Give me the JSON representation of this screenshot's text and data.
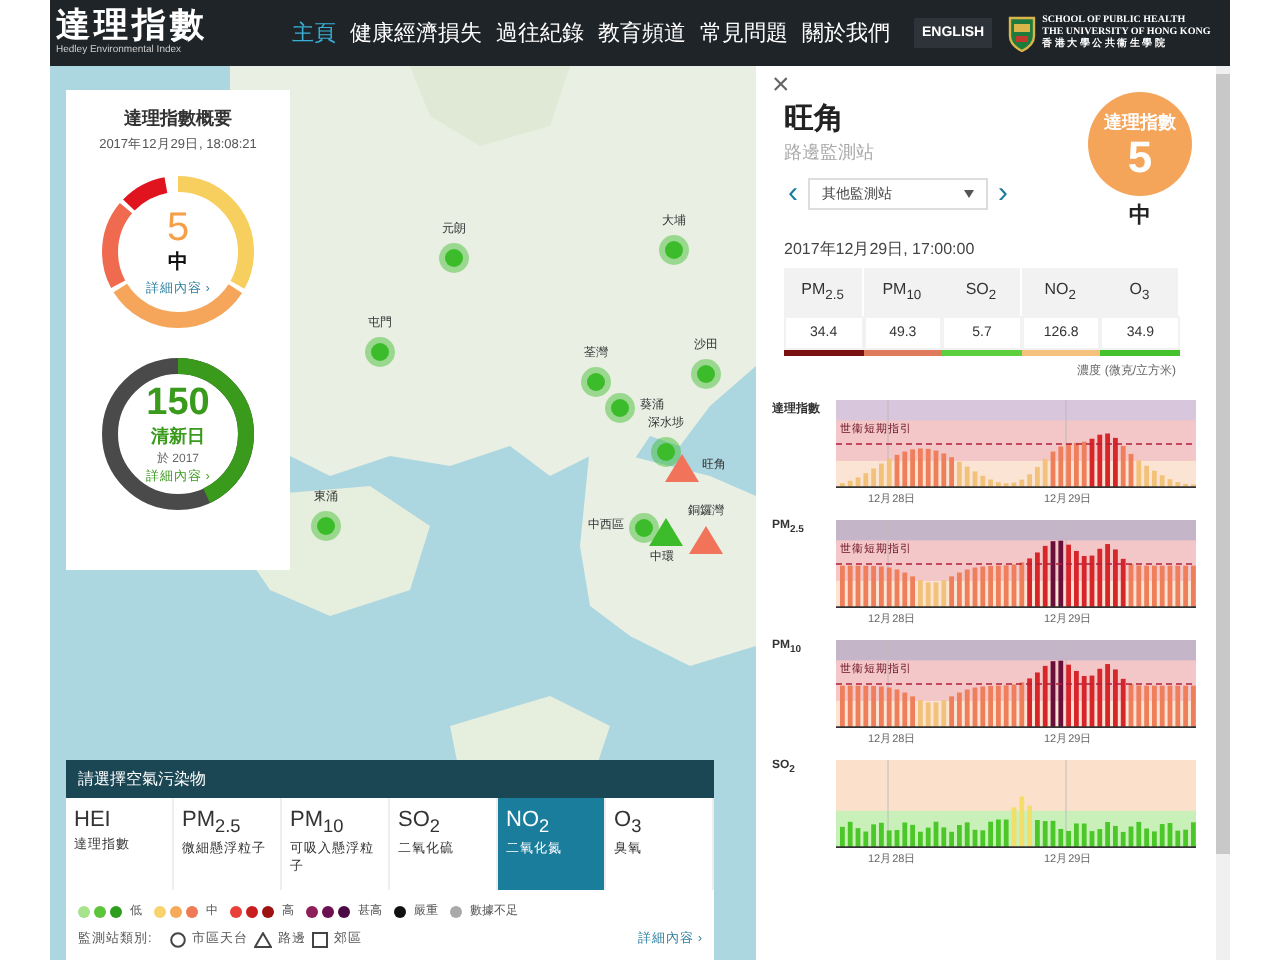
{
  "header": {
    "logo": "達理指數",
    "logo_sub": "Hedley Environmental Index",
    "nav": [
      {
        "label": "主頁",
        "selected": true
      },
      {
        "label": "健康經濟損失",
        "selected": false
      },
      {
        "label": "過往紀錄",
        "selected": false
      },
      {
        "label": "教育頻道",
        "selected": false
      },
      {
        "label": "常見問題",
        "selected": false
      },
      {
        "label": "關於我們",
        "selected": false
      }
    ],
    "language_button": "ENGLISH",
    "school": {
      "line1": "SCHOOL OF PUBLIC HEALTH",
      "line2": "THE UNIVERSITY OF HONG KONG",
      "line3": "香 港 大 學 公 共 衞 生 學 院"
    }
  },
  "summary": {
    "title": "達理指數概要",
    "time": "2017年12月29日, 18:08:21",
    "index": {
      "value": "5",
      "band": "中",
      "link": "詳細內容 ›"
    },
    "clean_days": {
      "value": "150",
      "label": "清新日",
      "year": "於 2017",
      "link": "詳細內容 ›",
      "level": 0.43
    }
  },
  "map": {
    "stations": [
      {
        "name": "元朗",
        "kind": "circle",
        "color": "#3cbc2a"
      },
      {
        "name": "大埔",
        "kind": "circle",
        "color": "#3cbc2a"
      },
      {
        "name": "屯門",
        "kind": "circle",
        "color": "#3cbc2a"
      },
      {
        "name": "荃灣",
        "kind": "circle",
        "color": "#3cbc2a"
      },
      {
        "name": "葵涌",
        "kind": "circle",
        "color": "#3cbc2a"
      },
      {
        "name": "沙田",
        "kind": "circle",
        "color": "#3cbc2a"
      },
      {
        "name": "深水埗",
        "kind": "circle",
        "color": "#3cbc2a"
      },
      {
        "name": "旺角",
        "kind": "triangle",
        "color": "#f0735a"
      },
      {
        "name": "東涌",
        "kind": "circle",
        "color": "#3cbc2a"
      },
      {
        "name": "中西區",
        "kind": "circle",
        "color": "#3cbc2a"
      },
      {
        "name": "中環",
        "kind": "triangle",
        "color": "#3cbc2a"
      },
      {
        "name": "銅鑼灣",
        "kind": "triangle",
        "color": "#f0735a"
      }
    ]
  },
  "pollutant_panel": {
    "title": "請選擇空氣污染物",
    "tabs": [
      {
        "symbol": "HEI",
        "name": "達理指數",
        "selected": false
      },
      {
        "symbol": "PM$_{2.5}$",
        "name": "微細懸浮粒子",
        "selected": false
      },
      {
        "symbol": "PM$_{10}$",
        "name": "可吸入懸浮粒子",
        "selected": false
      },
      {
        "symbol": "SO$_{2}$",
        "name": "二氧化硫",
        "selected": false
      },
      {
        "symbol": "NO$_{2}$",
        "name": "二氧化氮",
        "selected": true
      },
      {
        "symbol": "O$_{3}$",
        "name": "臭氧",
        "selected": false
      }
    ],
    "legend": [
      {
        "label": "低",
        "dots": [
          {
            "color": "#a8e28c"
          },
          {
            "color": "#5cc53c"
          },
          {
            "color": "#2f9e1f"
          }
        ]
      },
      {
        "label": "中",
        "dots": [
          {
            "color": "#f7d36e"
          },
          {
            "color": "#f5aa5c"
          },
          {
            "color": "#ef7b56"
          }
        ]
      },
      {
        "label": "高",
        "dots": [
          {
            "color": "#e8413a"
          },
          {
            "color": "#c81e1e"
          },
          {
            "color": "#9b1313"
          }
        ]
      },
      {
        "label": "甚高",
        "dots": [
          {
            "color": "#8e1f5a"
          },
          {
            "color": "#6b1050"
          },
          {
            "color": "#4a0a45"
          }
        ]
      },
      {
        "label": "嚴重",
        "dots": [
          {
            "color": "#111111"
          }
        ]
      },
      {
        "label": "數據不足",
        "dots": [
          {
            "color": "#aaaaaa"
          }
        ]
      }
    ],
    "station_types_label": "監測站類別:",
    "station_types": [
      {
        "kind": "circle",
        "label": "市區天台"
      },
      {
        "kind": "triangle",
        "label": "路邊"
      },
      {
        "kind": "square",
        "label": "郊區"
      }
    ],
    "link": "詳細內容 ›"
  },
  "station_panel": {
    "close": "×",
    "name": "旺角",
    "type": "路邊監測站",
    "prev": "‹",
    "select": "其他監測站",
    "next": "›",
    "badge": {
      "label": "達理指數",
      "value": "5",
      "band": "中"
    },
    "time": "2017年12月29日, 17:00:00",
    "readings": [
      {
        "pollutant": "PM$_{2.5}$",
        "value": "34.4",
        "color": "#7a1010"
      },
      {
        "pollutant": "PM$_{10}$",
        "value": "49.3",
        "color": "#e07a5c"
      },
      {
        "pollutant": "SO$_{2}$",
        "value": "5.7",
        "color": "#5ccf3c"
      },
      {
        "pollutant": "NO$_{2}$",
        "value": "126.8",
        "color": "#f5c27e"
      },
      {
        "pollutant": "O$_{3}$",
        "value": "34.9",
        "color": "#43c22c"
      }
    ],
    "unit": "濃度 (微克/立方米)",
    "charts": [
      {
        "title": "達理指數",
        "guideline": "世衞短期指引",
        "dates": [
          "12月28日",
          "12月29日"
        ]
      },
      {
        "title": "PM$_{2.5}$",
        "guideline": "世衞短期指引",
        "dates": [
          "12月28日",
          "12月29日"
        ]
      },
      {
        "title": "PM$_{10}$",
        "guideline": "世衞短期指引",
        "dates": [
          "12月28日",
          "12月29日"
        ]
      },
      {
        "title": "SO$_{2}$",
        "dates": [
          "12月28日",
          "12月29日"
        ]
      }
    ]
  }
}
